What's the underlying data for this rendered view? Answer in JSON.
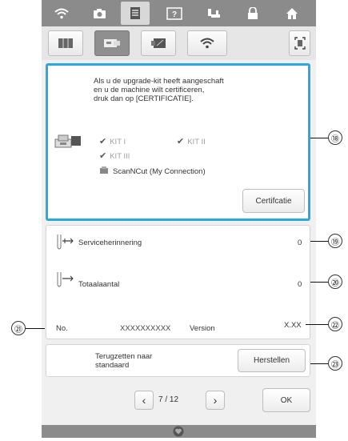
{
  "tabs": {
    "wifi": "wifi-icon"
  },
  "certificate": {
    "message": "Als u de upgrade-kit heeft aangeschaft\nen u de machine wilt certificeren,\ndruk dan op [CERTIFICATIE].",
    "kits": [
      "KIT I",
      "KIT II",
      "KIT III"
    ],
    "scanncut": "ScanNCut (My Connection)",
    "button": "Certifcatie"
  },
  "info": {
    "service_reminder_label": "Serviceherinnering",
    "service_reminder_value": "0",
    "total_label": "Totaalaantal",
    "total_value": "0",
    "no_label": "No.",
    "no_value": "XXXXXXXXXX",
    "version_label": "Version",
    "version_value": "X.XX"
  },
  "reset": {
    "label": "Terugzetten naar\nstandaard",
    "button": "Herstellen"
  },
  "pager": {
    "page": "7",
    "separator": "/",
    "total": "12",
    "ok": "OK"
  },
  "callouts": [
    "⑱",
    "⑲",
    "⑳",
    "㉑",
    "㉒",
    "㉓"
  ],
  "colors": {
    "accent": "#2aa8e0",
    "bar": "#8b8b8b"
  }
}
